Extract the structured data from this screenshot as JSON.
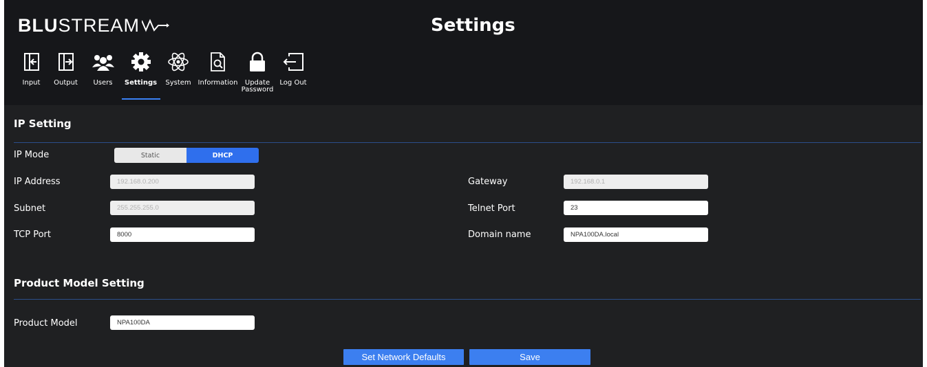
{
  "brand": {
    "logo_bold": "BLU",
    "logo_light": "STREAM"
  },
  "page": {
    "title": "Settings"
  },
  "nav": {
    "items": [
      {
        "label": "Input",
        "icon": "input-icon"
      },
      {
        "label": "Output",
        "icon": "output-icon"
      },
      {
        "label": "Users",
        "icon": "users-icon"
      },
      {
        "label": "Settings",
        "icon": "gear-icon",
        "active": true
      },
      {
        "label": "System",
        "icon": "atom-icon"
      },
      {
        "label": "Information",
        "icon": "document-search-icon"
      },
      {
        "label": "Update\nPassword",
        "icon": "lock-icon"
      },
      {
        "label": "Log Out",
        "icon": "logout-icon"
      }
    ]
  },
  "ip_setting": {
    "title": "IP Setting",
    "ip_mode": {
      "label": "IP Mode",
      "options": [
        "Static",
        "DHCP"
      ],
      "selected": "DHCP"
    },
    "ip_address": {
      "label": "IP Address",
      "value": "192.168.0.200"
    },
    "subnet": {
      "label": "Subnet",
      "value": "255.255.255.0"
    },
    "tcp_port": {
      "label": "TCP Port",
      "value": "8000"
    },
    "gateway": {
      "label": "Gateway",
      "value": "192.168.0.1"
    },
    "telnet_port": {
      "label": "Telnet Port",
      "value": "23"
    },
    "domain_name": {
      "label": "Domain name",
      "value": "NPA100DA.local"
    }
  },
  "product_model_setting": {
    "title": "Product Model Setting",
    "product_model": {
      "label": "Product Model",
      "value": "NPA100DA"
    }
  },
  "actions": {
    "set_network_defaults": "Set Network Defaults",
    "save": "Save"
  },
  "colors": {
    "accent": "#3c7ff0",
    "background": "#1f2022",
    "header": "#16171a",
    "divider": "#2b4f8c"
  }
}
